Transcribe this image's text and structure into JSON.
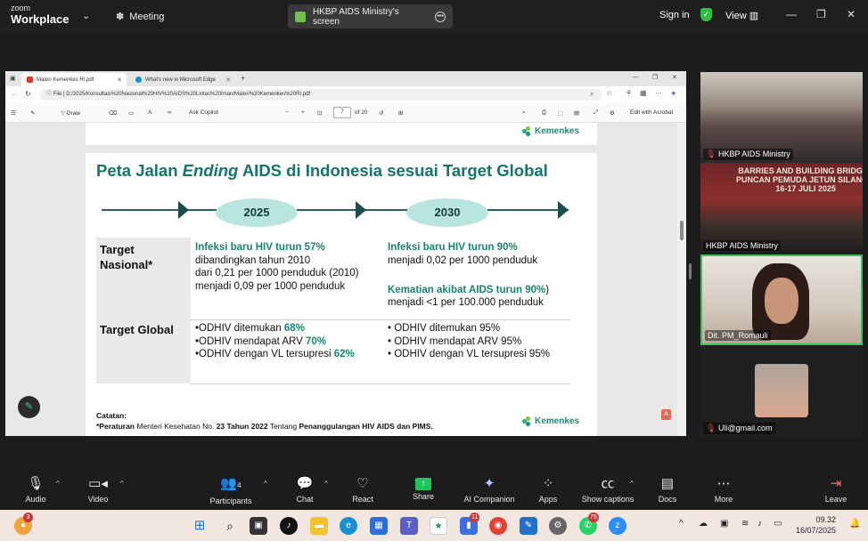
{
  "zoom": {
    "brand_line1": "zoom",
    "brand_line2": "Workplace",
    "meeting_label": "Meeting",
    "share_title": "HKBP AIDS Ministry's screen",
    "signin": "Sign in",
    "view": "View"
  },
  "browser": {
    "tabs": [
      {
        "label": "Materi Kemenkes RI.pdf"
      },
      {
        "label": "What's new in Microsoft Edge"
      }
    ],
    "file_label": "File",
    "url": "D:/2025/Konsultasi%20Nasional%20HIV%20AIDS%20Lintas%20Iman/Materi%20Kemenkes%20RI.pdf",
    "toolbar": {
      "draw": "Draw",
      "ask_copilot": "Ask Copilot",
      "page_current": "7",
      "page_total": "of 20",
      "edit_acrobat": "Edit with Acrobat"
    }
  },
  "slide": {
    "logo_text": "Kemenkes",
    "title_pre": "Peta Jalan ",
    "title_em": "Ending",
    "title_post": " AIDS di Indonesia sesuai Target Global",
    "years": [
      "2025",
      "2030"
    ],
    "row1_label_a": "Target",
    "row1_label_b": "Nasional*",
    "row2_label": "Target Global",
    "n2025_hl": "Infeksi baru HIV turun 57%",
    "n2025_l2": "dibandingkan tahun 2010",
    "n2025_l3": "dari 0,21 per 1000 penduduk (2010)",
    "n2025_l4": "menjadi 0,09 per 1000 penduduk",
    "n2030_hl": "Infeksi baru HIV turun 90%",
    "n2030_l2": "menjadi 0,02 per 1000 penduduk",
    "n2030_hl2": "Kematian akibat AIDS turun 90%",
    "n2030_hl2_tail": ")",
    "n2030_l4": "menjadi <1 per 100.000 penduduk",
    "g2025": [
      {
        "text": "•ODHIV ditemukan ",
        "hl": "68%"
      },
      {
        "text": "•ODHIV mendapat ARV ",
        "hl": "70%"
      },
      {
        "text": "•ODHIV dengan VL tersupresi ",
        "hl": "62%"
      }
    ],
    "g2030": [
      "• ODHIV ditemukan 95%",
      "• ODHIV mendapat ARV 95%",
      "• ODHIV dengan VL tersupresi 95%"
    ],
    "catatan_label": "Catatan:",
    "catatan_pre": "*Peraturan ",
    "catatan_mid1": "Menteri Kesehatan No. ",
    "catatan_b1": "23 Tahun 2022",
    "catatan_mid2": " Tentang ",
    "catatan_b2": "Penanggulangan HIV AIDS dan PIMS."
  },
  "participants": [
    {
      "name": "HKBP AIDS Ministry"
    },
    {
      "name": "HKBP AIDS Ministry",
      "banner": "BARRIES AND BUILDING BRIDGES\nPUNCAN PEMUDA JETUN SILANGIT\n16-17 JULI 2025"
    },
    {
      "name": "Dit. PM_Romauli"
    },
    {
      "name": "Uli@gmail.com"
    }
  ],
  "controls": [
    {
      "id": "audio",
      "label": "Audio"
    },
    {
      "id": "video",
      "label": "Video"
    },
    {
      "id": "participants",
      "label": "Participants",
      "count": "4"
    },
    {
      "id": "chat",
      "label": "Chat"
    },
    {
      "id": "react",
      "label": "React"
    },
    {
      "id": "share",
      "label": "Share"
    },
    {
      "id": "ai",
      "label": "AI Companion"
    },
    {
      "id": "apps",
      "label": "Apps"
    },
    {
      "id": "captions",
      "label": "Show captions"
    },
    {
      "id": "docs",
      "label": "Docs"
    },
    {
      "id": "more",
      "label": "More"
    },
    {
      "id": "leave",
      "label": "Leave"
    }
  ],
  "taskbar": {
    "badge_left": "3",
    "badge_teams": "11",
    "badge_whatsapp": "75",
    "time": "09.32",
    "date": "16/07/2025"
  },
  "colors": {
    "accent_green": "#14766a",
    "highlight_green": "#14866f",
    "year_pill": "#b8e6de",
    "active_speaker": "#3fbf5a"
  }
}
